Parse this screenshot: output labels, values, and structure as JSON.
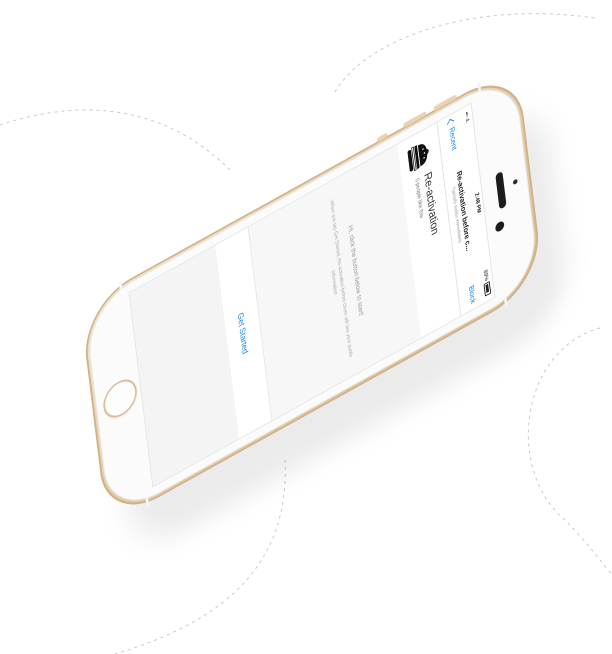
{
  "status_bar": {
    "signal": "•••◦◦ JL",
    "time": "2:48 PM",
    "battery": "89%"
  },
  "nav": {
    "back_label": "Recent",
    "title": "Re-activation before c...",
    "subtitle": "Typically replies immediately",
    "block_label": "Block"
  },
  "profile": {
    "name": "Re-activation",
    "likes": "0 people like this"
  },
  "messages": {
    "greeting": "Hi, click the button below to start!",
    "info": "When you tap Get Started, Re-activation before churn will see your public information"
  },
  "cta": {
    "get_started": "Get Started"
  },
  "colors": {
    "accent": "#1a86e8",
    "phone_gold": "#e4cba8",
    "phone_face": "#fbfbfb"
  },
  "icons": {
    "profile": "burger-icon",
    "back": "chevron-left-icon",
    "battery": "battery-icon"
  }
}
